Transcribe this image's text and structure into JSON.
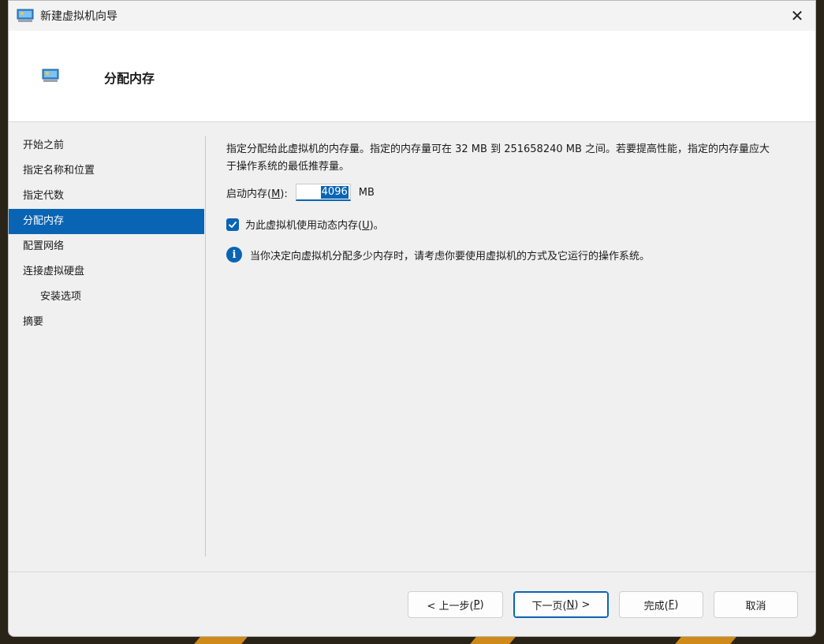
{
  "window": {
    "title": "新建虚拟机向导",
    "close_glyph": "✕"
  },
  "header": {
    "title": "分配内存",
    "icon": "virtual-machine-icon"
  },
  "sidebar": {
    "items": [
      {
        "label": "开始之前",
        "active": false,
        "sub": false
      },
      {
        "label": "指定名称和位置",
        "active": false,
        "sub": false
      },
      {
        "label": "指定代数",
        "active": false,
        "sub": false
      },
      {
        "label": "分配内存",
        "active": true,
        "sub": false
      },
      {
        "label": "配置网络",
        "active": false,
        "sub": false
      },
      {
        "label": "连接虚拟硬盘",
        "active": false,
        "sub": false
      },
      {
        "label": "安装选项",
        "active": false,
        "sub": true
      },
      {
        "label": "摘要",
        "active": false,
        "sub": false
      }
    ]
  },
  "content": {
    "description_line1": "指定分配给此虚拟机的内存量。指定的内存量可在 32 MB 到 251658240 MB 之间。若要提高性能，指定的内存量应大",
    "description_line2": "于操作系统的最低推荐量。",
    "startup_memory": {
      "label_prefix": "启动内存(",
      "label_key": "M",
      "label_suffix": "):",
      "value": "4096",
      "unit": "MB"
    },
    "dynamic_memory": {
      "checked": true,
      "label_prefix": "为此虚拟机使用动态内存(",
      "label_key": "U",
      "label_suffix": ")。"
    },
    "info": {
      "icon": "info-icon",
      "glyph": "i",
      "text": "当你决定向虚拟机分配多少内存时，请考虑你要使用虚拟机的方式及它运行的操作系统。"
    }
  },
  "buttons": {
    "previous": {
      "prefix": "< 上一步(",
      "key": "P",
      "suffix": ")"
    },
    "next": {
      "prefix": "下一页(",
      "key": "N",
      "suffix": ") >"
    },
    "finish": {
      "prefix": "完成(",
      "key": "F",
      "suffix": ")"
    },
    "cancel": {
      "label": "取消"
    }
  },
  "colors": {
    "accent": "#0a64b4",
    "window_bg": "#f0f0f0",
    "header_bg": "#ffffff"
  }
}
